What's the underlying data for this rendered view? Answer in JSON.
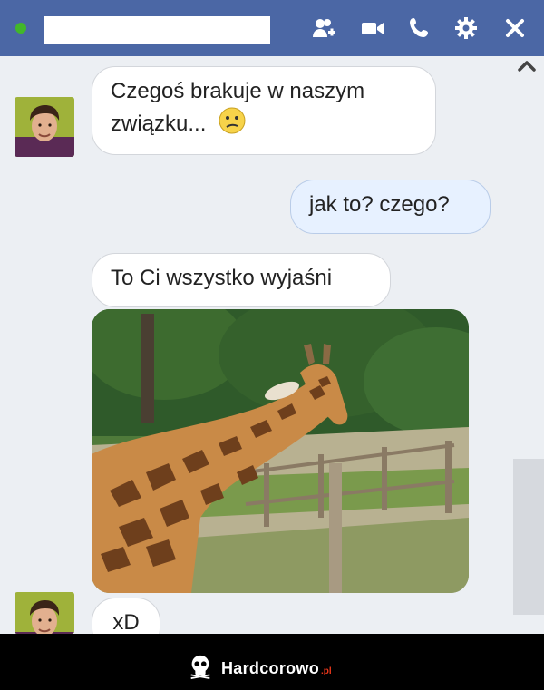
{
  "header": {
    "status_color": "#42b72a",
    "icons": [
      "add-friend-icon",
      "video-camera-icon",
      "phone-icon",
      "gear-icon",
      "close-icon"
    ]
  },
  "messages": [
    {
      "direction": "in",
      "text": "Czegoś brakuje w naszym związku...",
      "emoji": "confused-face-icon"
    },
    {
      "direction": "out",
      "text": "jak to? czego?"
    },
    {
      "direction": "in",
      "text": "To Ci wszystko wyjaśni"
    },
    {
      "direction": "in",
      "type": "photo",
      "image": "giraffe-photo"
    },
    {
      "direction": "in",
      "text": "xD"
    }
  ],
  "footer": {
    "brand": "Hardcorowo",
    "brand_suffix": ".pl"
  },
  "colors": {
    "header": "#4b67a5",
    "chat_bg": "#eceff3",
    "outgoing_bubble": "#e7f1ff",
    "footer": "#000000"
  }
}
